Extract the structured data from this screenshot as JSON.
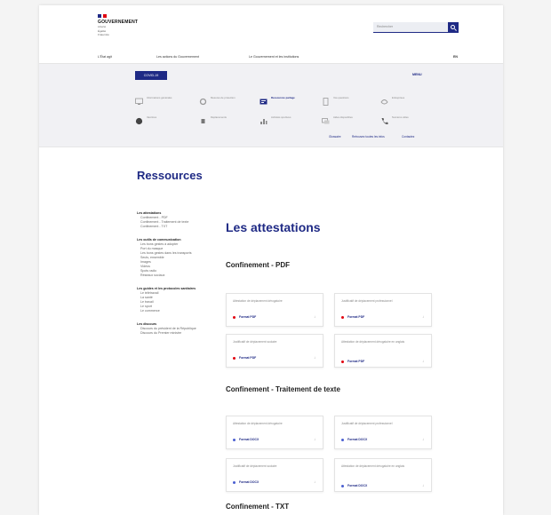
{
  "header": {
    "brand": "GOUVERNEMENT",
    "motto": [
      "Liberté",
      "Égalité",
      "Fraternité"
    ],
    "search_placeholder": "Rechercher"
  },
  "nav": {
    "items": [
      "L'État agit",
      "Les actions du Gouvernement",
      "Le Gouvernement et les institutions"
    ],
    "lang": "EN"
  },
  "covid": {
    "button_label": "COVID-19",
    "menu_label": "MENU",
    "items": [
      {
        "label": "Informations générales",
        "icon": "monitor-icon",
        "active": false
      },
      {
        "label": "Mesures de protection",
        "icon": "settings-icon",
        "active": false
      },
      {
        "label": "Ressources partage",
        "icon": "resources-icon",
        "active": true
      },
      {
        "label": "Vos questions",
        "icon": "document-icon",
        "active": false
      },
      {
        "label": "Entreprises",
        "icon": "handshake-icon",
        "active": false
      },
      {
        "label": "Vaccinés",
        "icon": "shield-icon",
        "active": false
      },
      {
        "label": "Déplacements",
        "icon": "travel-icon",
        "active": false
      },
      {
        "label": "Activités sportives",
        "icon": "activity-icon",
        "active": false
      },
      {
        "label": "Aides disponibles",
        "icon": "chat-icon",
        "active": false
      },
      {
        "label": "Numéros utiles",
        "icon": "phone-icon",
        "active": false
      }
    ],
    "links": [
      "Glossaire",
      "Retrouvez toutes les infos",
      "Contactez"
    ]
  },
  "page": {
    "title": "Ressources",
    "main_title": "Les attestations"
  },
  "sidebar": {
    "groups": [
      {
        "head": "Les attestations",
        "subs": [
          "Confinement - PDF",
          "Confinement - Traitement de texte",
          "Confinement - TXT"
        ]
      },
      {
        "head": "Les outils de communication",
        "subs": [
          "Les bons gestes à adopter",
          "Port du masque",
          "Les bons gestes dans les transports",
          "Seuls, ensemble",
          "Images",
          "Vidéos",
          "Spots radio",
          "Réseaux sociaux"
        ]
      },
      {
        "head": "Les guides et les protocoles sanitaires",
        "subs": [
          "Le télétravail",
          "La santé",
          "Le travail",
          "Le sport",
          "Le commerce"
        ]
      },
      {
        "head": "Les discours",
        "subs": [
          "Discours du président de la République",
          "Discours du Premier ministre"
        ]
      }
    ]
  },
  "sections": [
    {
      "title": "Confinement - PDF",
      "cards": [
        {
          "title": "Attestation de déplacement dérogatoire",
          "format": "Format PDF"
        },
        {
          "title": "Justificatif de déplacement professionnel",
          "format": "Format PDF"
        },
        {
          "title": "Justificatif de déplacement scolaire",
          "format": "Format PDF"
        },
        {
          "title": "Attestation de déplacement dérogatoire en anglais",
          "format": "Format PDF"
        }
      ]
    },
    {
      "title": "Confinement - Traitement de texte",
      "cards": [
        {
          "title": "Attestation de déplacement dérogatoire",
          "format": "Format DOCX"
        },
        {
          "title": "Justificatif de déplacement professionnel",
          "format": "Format DOCX"
        },
        {
          "title": "Justificatif de déplacement scolaire",
          "format": "Format DOCX"
        },
        {
          "title": "Attestation de déplacement dérogatoire en anglais",
          "format": "Format DOCX"
        }
      ]
    },
    {
      "title": "Confinement - TXT",
      "cards": []
    }
  ],
  "colors": {
    "accent": "#1f2a85",
    "pdf_dot": "#e1000f",
    "docx_dot": "#4a5fd1"
  }
}
